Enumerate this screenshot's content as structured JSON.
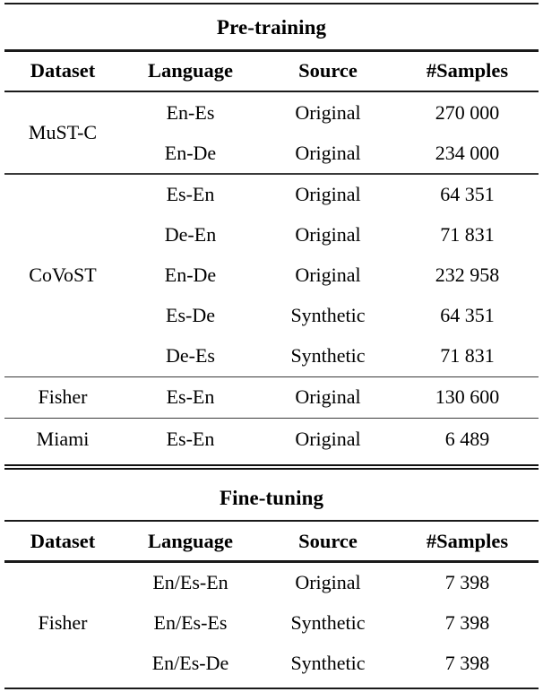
{
  "figure": {
    "kind": "two-part-dataset-table",
    "columns": [
      "Dataset",
      "Language",
      "Source",
      "#Samples"
    ]
  },
  "sections": [
    {
      "caption": "Pre-training",
      "headers": {
        "dataset": "Dataset",
        "language": "Language",
        "source": "Source",
        "samples": "#Samples"
      },
      "groups": [
        {
          "dataset": "MuST-C",
          "rows": [
            {
              "language": "En-Es",
              "source": "Original",
              "samples": "270 000"
            },
            {
              "language": "En-De",
              "source": "Original",
              "samples": "234 000"
            }
          ]
        },
        {
          "dataset": "CoVoST",
          "rows": [
            {
              "language": "Es-En",
              "source": "Original",
              "samples": "64 351"
            },
            {
              "language": "De-En",
              "source": "Original",
              "samples": "71 831"
            },
            {
              "language": "En-De",
              "source": "Original",
              "samples": "232 958"
            },
            {
              "language": "Es-De",
              "source": "Synthetic",
              "samples": "64 351"
            },
            {
              "language": "De-Es",
              "source": "Synthetic",
              "samples": "71 831"
            }
          ]
        },
        {
          "dataset": "Fisher",
          "rows": [
            {
              "language": "Es-En",
              "source": "Original",
              "samples": "130 600"
            }
          ]
        },
        {
          "dataset": "Miami",
          "rows": [
            {
              "language": "Es-En",
              "source": "Original",
              "samples": "6 489"
            }
          ]
        }
      ]
    },
    {
      "caption": "Fine-tuning",
      "headers": {
        "dataset": "Dataset",
        "language": "Language",
        "source": "Source",
        "samples": "#Samples"
      },
      "groups": [
        {
          "dataset": "Fisher",
          "rows": [
            {
              "language": "En/Es-En",
              "source": "Original",
              "samples": "7 398"
            },
            {
              "language": "En/Es-Es",
              "source": "Synthetic",
              "samples": "7 398"
            },
            {
              "language": "En/Es-De",
              "source": "Synthetic",
              "samples": "7 398"
            }
          ]
        }
      ]
    }
  ]
}
